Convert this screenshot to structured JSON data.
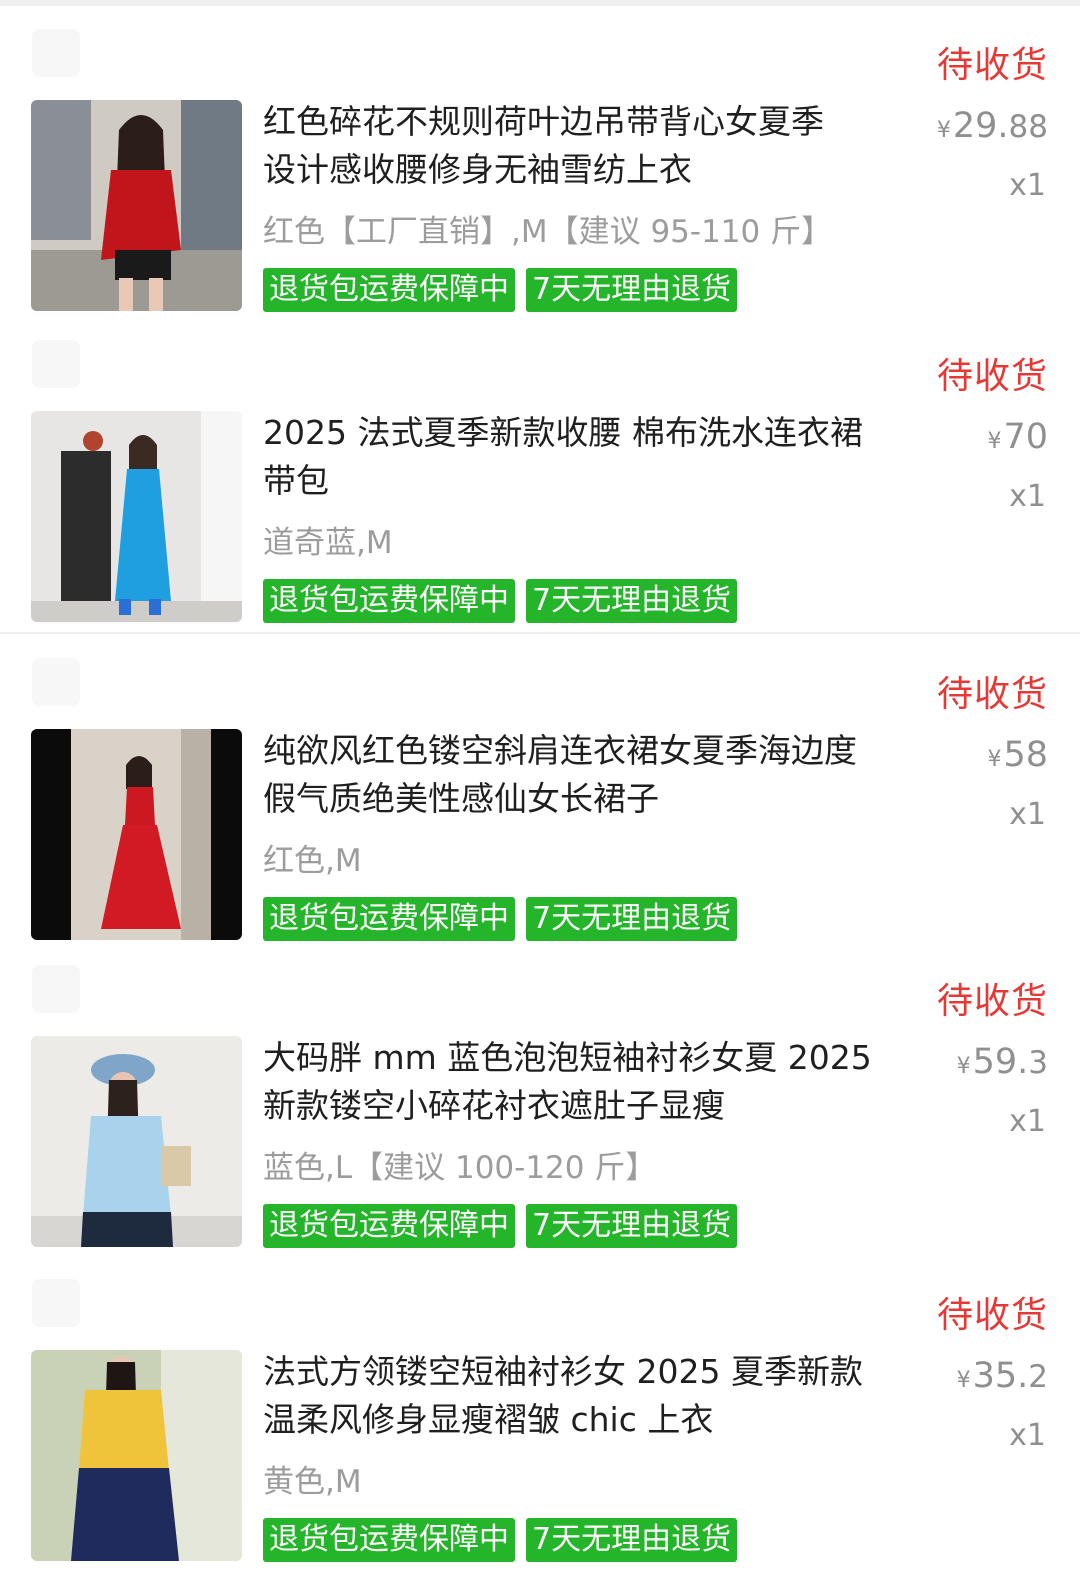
{
  "orders": [
    {
      "shop_name": "",
      "status": "待收货",
      "title": "红色碎花不规则荷叶边吊带背心女夏季\n设计感收腰修身无袖雪纺上衣",
      "spec": "红色【工厂直销】,M【建议 95-110 斤】",
      "price_symbol": "¥",
      "price_int": "29.",
      "price_dec": "88",
      "qty": "x1",
      "tags": [
        "退货包运费保障中",
        "7天无理由退货"
      ],
      "image": "red-floral-top-photo"
    },
    {
      "shop_name": "",
      "status": "待收货",
      "title": "2025 法式夏季新款收腰 棉布洗水连衣裙\n带包",
      "spec": "道奇蓝,M",
      "price_symbol": "¥",
      "price_int": "70",
      "price_dec": "",
      "qty": "x1",
      "tags": [
        "退货包运费保障中",
        "7天无理由退货"
      ],
      "image": "blue-dress-photo"
    },
    {
      "shop_name": "",
      "status": "待收货",
      "title": "纯欲风红色镂空斜肩连衣裙女夏季海边度\n假气质绝美性感仙女长裙子",
      "spec": "红色,M",
      "price_symbol": "¥",
      "price_int": "58",
      "price_dec": "",
      "qty": "x1",
      "tags": [
        "退货包运费保障中",
        "7天无理由退货"
      ],
      "image": "red-long-dress-photo"
    },
    {
      "shop_name": "",
      "status": "待收货",
      "title": "大码胖 mm 蓝色泡泡短袖衬衫女夏 2025\n新款镂空小碎花衬衣遮肚子显瘦",
      "spec": "蓝色,L【建议 100-120 斤】",
      "price_symbol": "¥",
      "price_int": "59.",
      "price_dec": "3",
      "qty": "x1",
      "tags": [
        "退货包运费保障中",
        "7天无理由退货"
      ],
      "image": "blue-shirt-photo"
    },
    {
      "shop_name": "",
      "status": "待收货",
      "title": "法式方领镂空短袖衬衫女 2025 夏季新款\n温柔风修身显瘦褶皱 chic 上衣",
      "spec": "黄色,M",
      "price_symbol": "¥",
      "price_int": "35.",
      "price_dec": "2",
      "qty": "x1",
      "tags": [
        "退货包运费保障中",
        "7天无理由退货"
      ],
      "image": "yellow-top-photo"
    }
  ],
  "colors": {
    "status": "#e53935",
    "tag_bg": "#25b52a",
    "muted": "#9c9c9c"
  }
}
